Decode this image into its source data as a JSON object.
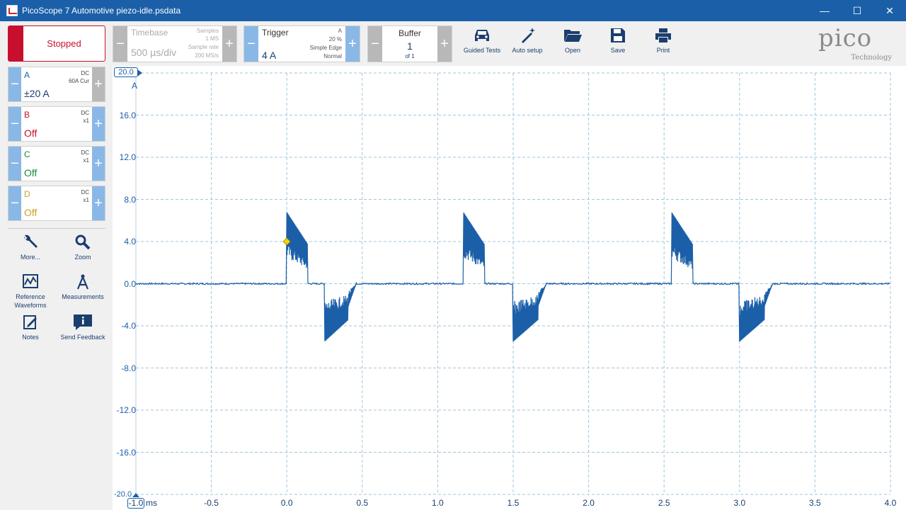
{
  "window": {
    "title": "PicoScope 7 Automotive piezo-idle.psdata",
    "minimize": "—",
    "maximize": "☐",
    "close": "✕"
  },
  "toolbar": {
    "status": "Stopped",
    "timebase": {
      "label": "Timebase",
      "value": "500 µs/div",
      "samples_label": "Samples",
      "samples_value": "1 MS",
      "rate_label": "Sample rate",
      "rate_value": "200 MS/s"
    },
    "trigger": {
      "label": "Trigger",
      "value": "4 A",
      "channel": "A",
      "pretrigger": "20 %",
      "type": "Simple Edge",
      "mode": "Normal"
    },
    "buffer": {
      "label": "Buffer",
      "value": "1",
      "of": "of 1"
    },
    "buttons": {
      "guided_tests": "Guided Tests",
      "auto_setup": "Auto setup",
      "open": "Open",
      "save": "Save",
      "print": "Print"
    },
    "logo": {
      "text": "pico",
      "sub": "Technology"
    }
  },
  "channels": [
    {
      "name": "A",
      "coupling": "DC",
      "probe": "60A Cur",
      "range": "±20 A",
      "color": "#1b5fa8"
    },
    {
      "name": "B",
      "coupling": "DC",
      "probe": "x1",
      "range": "Off",
      "color": "#c8102e"
    },
    {
      "name": "C",
      "coupling": "DC",
      "probe": "x1",
      "range": "Off",
      "color": "#1a8a3a"
    },
    {
      "name": "D",
      "coupling": "DC",
      "probe": "x1",
      "range": "Off",
      "color": "#c9a227"
    }
  ],
  "sidebar_tools": {
    "more": "More...",
    "zoom": "Zoom",
    "reference": "Reference Waveforms",
    "measurements": "Measurements",
    "notes": "Notes",
    "feedback": "Send Feedback"
  },
  "chart_data": {
    "type": "line",
    "y_unit": "A",
    "x_unit": "ms",
    "ylim": [
      -20,
      20
    ],
    "xlim": [
      -1.0,
      4.0
    ],
    "y_top_label": "20.0",
    "y_bottom_label": "-20.0",
    "yticks": [
      "16.0",
      "12.0",
      "8.0",
      "4.0",
      "0.0",
      "-4.0",
      "-8.0",
      "-12.0",
      "-16.0"
    ],
    "xticks": [
      "-1.0",
      "-0.5",
      "0.0",
      "0.5",
      "1.0",
      "1.5",
      "2.0",
      "2.5",
      "3.0",
      "3.5",
      "4.0"
    ],
    "trigger_point": {
      "x": 0.0,
      "y": 4.0
    },
    "series": [
      {
        "color": "#1b5fa8",
        "events": [
          {
            "pos_start": 0.0,
            "pos_end": 0.14,
            "pos_peak": 6.8,
            "neg_start": 0.25,
            "neg_end": 0.46,
            "neg_peak": -5.5
          },
          {
            "pos_start": 1.17,
            "pos_end": 1.31,
            "pos_peak": 6.8,
            "neg_start": 1.5,
            "neg_end": 1.72,
            "neg_peak": -5.5
          },
          {
            "pos_start": 2.55,
            "pos_end": 2.69,
            "pos_peak": 6.8,
            "neg_start": 3.0,
            "neg_end": 3.22,
            "neg_peak": -5.5
          }
        ]
      }
    ]
  }
}
